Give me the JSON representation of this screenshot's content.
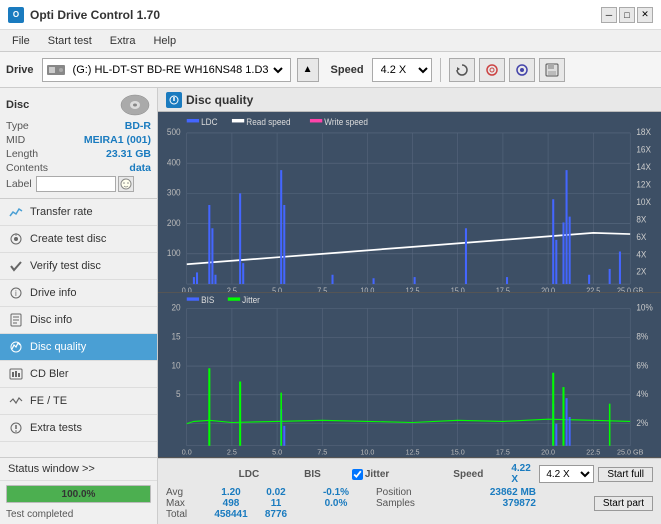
{
  "titlebar": {
    "title": "Opti Drive Control 1.70",
    "icon": "O",
    "minimize": "─",
    "maximize": "□",
    "close": "✕"
  },
  "menubar": {
    "items": [
      "File",
      "Start test",
      "Extra",
      "Help"
    ]
  },
  "toolbar": {
    "drive_label": "Drive",
    "drive_value": "(G:) HL-DT-ST BD-RE  WH16NS48 1.D3",
    "speed_label": "Speed",
    "speed_value": "4.2 X"
  },
  "sidebar": {
    "disc_label": "Disc",
    "disc_fields": [
      {
        "label": "Type",
        "value": "BD-R"
      },
      {
        "label": "MID",
        "value": "MEIRA1 (001)"
      },
      {
        "label": "Length",
        "value": "23.31 GB"
      },
      {
        "label": "Contents",
        "value": "data"
      }
    ],
    "label_text": "Label",
    "nav_items": [
      {
        "id": "transfer-rate",
        "label": "Transfer rate",
        "icon": "📈"
      },
      {
        "id": "create-test-disc",
        "label": "Create test disc",
        "icon": "💿"
      },
      {
        "id": "verify-test-disc",
        "label": "Verify test disc",
        "icon": "✔"
      },
      {
        "id": "drive-info",
        "label": "Drive info",
        "icon": "ℹ"
      },
      {
        "id": "disc-info",
        "label": "Disc info",
        "icon": "📋"
      },
      {
        "id": "disc-quality",
        "label": "Disc quality",
        "icon": "★",
        "active": true
      },
      {
        "id": "cd-bler",
        "label": "CD Bler",
        "icon": "📊"
      },
      {
        "id": "fe-te",
        "label": "FE / TE",
        "icon": "📉"
      },
      {
        "id": "extra-tests",
        "label": "Extra tests",
        "icon": "🔧"
      }
    ],
    "status_window": "Status window >>",
    "progress_value": 100,
    "progress_text": "100.0%",
    "status_text": "Test completed"
  },
  "disc_quality": {
    "title": "Disc quality",
    "chart1": {
      "legend": [
        {
          "label": "LDC",
          "color": "#4466ff"
        },
        {
          "label": "Read speed",
          "color": "#ffffff"
        },
        {
          "label": "Write speed",
          "color": "#ff44aa"
        }
      ],
      "y_max": 500,
      "y_right_labels": [
        "18X",
        "16X",
        "14X",
        "12X",
        "10X",
        "8X",
        "6X",
        "4X",
        "2X"
      ],
      "x_labels": [
        "0.0",
        "2.5",
        "5.0",
        "7.5",
        "10.0",
        "12.5",
        "15.0",
        "17.5",
        "20.0",
        "22.5",
        "25.0 GB"
      ]
    },
    "chart2": {
      "legend": [
        {
          "label": "BIS",
          "color": "#4466ff"
        },
        {
          "label": "Jitter",
          "color": "#00ff00"
        }
      ],
      "y_max": 20,
      "y_right_labels": [
        "10%",
        "8%",
        "6%",
        "4%",
        "2%"
      ],
      "x_labels": [
        "0.0",
        "2.5",
        "5.0",
        "7.5",
        "10.0",
        "12.5",
        "15.0",
        "17.5",
        "20.0",
        "22.5",
        "25.0 GB"
      ]
    },
    "stats": {
      "headers": [
        "",
        "LDC",
        "BIS",
        "",
        "Jitter",
        "Speed",
        ""
      ],
      "avg": {
        "ldc": "1.20",
        "bis": "0.02",
        "jitter": "-0.1%"
      },
      "max": {
        "ldc": "498",
        "bis": "11",
        "jitter": "0.0%"
      },
      "total": {
        "ldc": "458441",
        "bis": "8776"
      },
      "speed_val": "4.22 X",
      "speed_label": "Speed",
      "position_label": "Position",
      "position_val": "23862 MB",
      "samples_label": "Samples",
      "samples_val": "379872",
      "speed_combo": "4.2 X",
      "start_full": "Start full",
      "start_part": "Start part"
    }
  }
}
